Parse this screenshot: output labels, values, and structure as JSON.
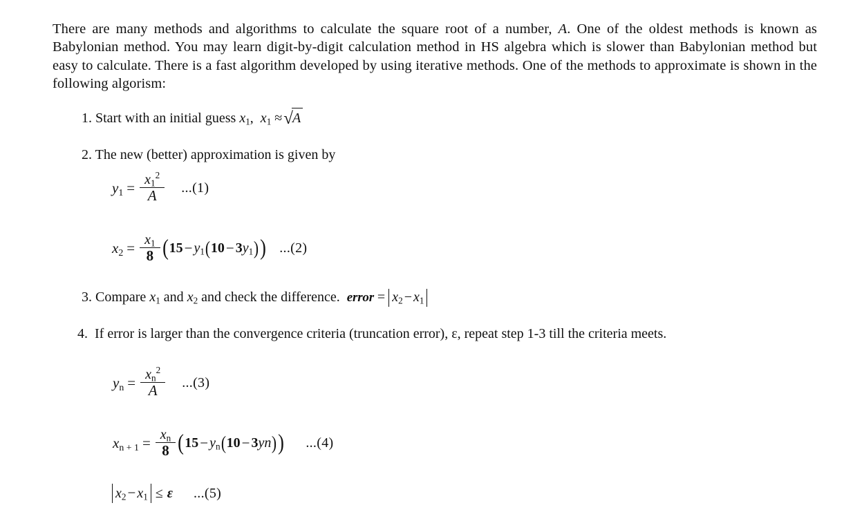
{
  "document": {
    "intro": {
      "part1": "There are many methods and algorithms to calculate the square root of a number, ",
      "var_A": "A",
      "part2": ". One of the oldest methods is known as Babylonian method. You may learn digit-by-digit calculation method in HS algebra which is slower than Babylonian method but easy to calculate. There is a fast algorithm developed by using iterative methods. One of the methods to approximate  is shown in the following algorism:"
    },
    "steps": [
      {
        "number": "1.",
        "text": "Start with an initial guess ",
        "math_var": "x",
        "math_sub": "1",
        "math_comma": ",",
        "approx_var": "x",
        "approx_sub": "1",
        "approx_symbol": "≈",
        "radical": "√",
        "radicand": "A"
      },
      {
        "number": "2.",
        "text": "The new (better) approximation is given by"
      },
      {
        "number": "3.",
        "text_a": "Compare ",
        "var1": "x",
        "var1_sub": "1",
        "text_b": " and ",
        "var2": "x",
        "var2_sub": "2",
        "text_c": " and check the difference.",
        "error_label": "error",
        "equals": "=",
        "abs_var2": "x",
        "abs_var2_sub": "2",
        "abs_minus": "−",
        "abs_var1": "x",
        "abs_var1_sub": "1"
      },
      {
        "number": "4.",
        "text": "If error is larger than the convergence criteria (truncation error), ε, repeat step 1-3 till the criteria meets."
      }
    ],
    "equations": [
      {
        "id": "eq-1",
        "lhs_var": "y",
        "lhs_sub": "1",
        "equals": "=",
        "num_var": "x",
        "num_sub": "1",
        "num_sup": "2",
        "den": "A",
        "label": "...(1)"
      },
      {
        "id": "eq-2",
        "lhs_var": "x",
        "lhs_sub": "2",
        "equals": "=",
        "num_var": "x",
        "num_sub": "1",
        "den": "8",
        "open_paren": "(",
        "const_15": "15",
        "minus": "−",
        "y_var": "y",
        "y_sub": "1",
        "inner_open": "(",
        "const_10": "10",
        "inner_minus": "−",
        "coef_3": "3",
        "y2_var": "y",
        "y2_sub": "1",
        "inner_close": ")",
        "close_paren": ")",
        "label": "...(2)"
      },
      {
        "id": "eq-3",
        "lhs_var": "y",
        "lhs_sub": "n",
        "equals": "=",
        "num_var": "x",
        "num_sub": "n",
        "num_sup": "2",
        "den": "A",
        "label": "...(3)"
      },
      {
        "id": "eq-4",
        "lhs_var": "x",
        "lhs_sub": "n + 1",
        "equals": "=",
        "num_var": "x",
        "num_sub": "n",
        "den": "8",
        "open_paren": "(",
        "const_15": "15",
        "minus": "−",
        "y_var": "y",
        "y_sub": "n",
        "inner_open": "(",
        "const_10": "10",
        "inner_minus": "−",
        "coef_3": "3",
        "yn_inline": "yn",
        "inner_close": ")",
        "close_paren": ")",
        "label": "...(4)"
      },
      {
        "id": "eq-5",
        "abs_var2": "x",
        "abs_var2_sub": "2",
        "abs_minus": "−",
        "abs_var1": "x",
        "abs_var1_sub": "1",
        "relation": "≤",
        "epsilon": "ε",
        "label": "...(5)"
      }
    ],
    "colors": {
      "text": "#111111",
      "background": "#ffffff"
    }
  }
}
